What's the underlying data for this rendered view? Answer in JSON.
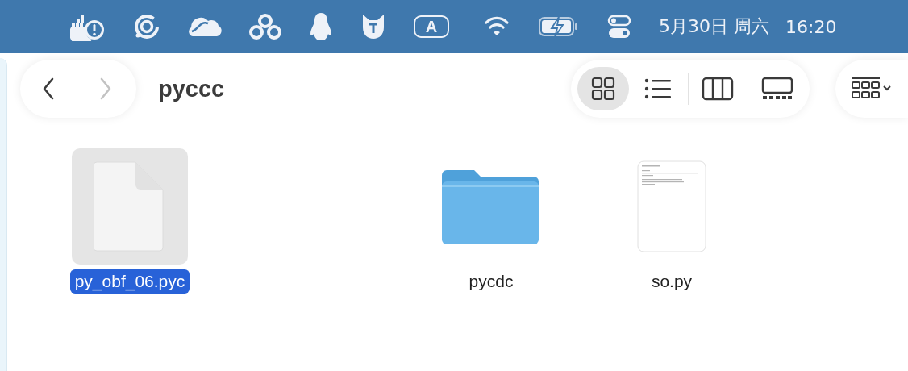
{
  "menu_bar": {
    "input_method": "A",
    "date": "5月30日 周六",
    "time": "16:20"
  },
  "toolbar": {
    "title": "pyccc",
    "back_disabled": false,
    "forward_disabled": true,
    "views": [
      {
        "kind": "icons",
        "selected": true
      },
      {
        "kind": "list",
        "selected": false
      },
      {
        "kind": "columns",
        "selected": false
      },
      {
        "kind": "gallery",
        "selected": false
      }
    ]
  },
  "files": [
    {
      "name": "py_obf_06.pyc",
      "kind": "document",
      "selected": true
    },
    {
      "name": "pycdc",
      "kind": "folder",
      "selected": false
    },
    {
      "name": "so.py",
      "kind": "text",
      "selected": false
    }
  ]
}
